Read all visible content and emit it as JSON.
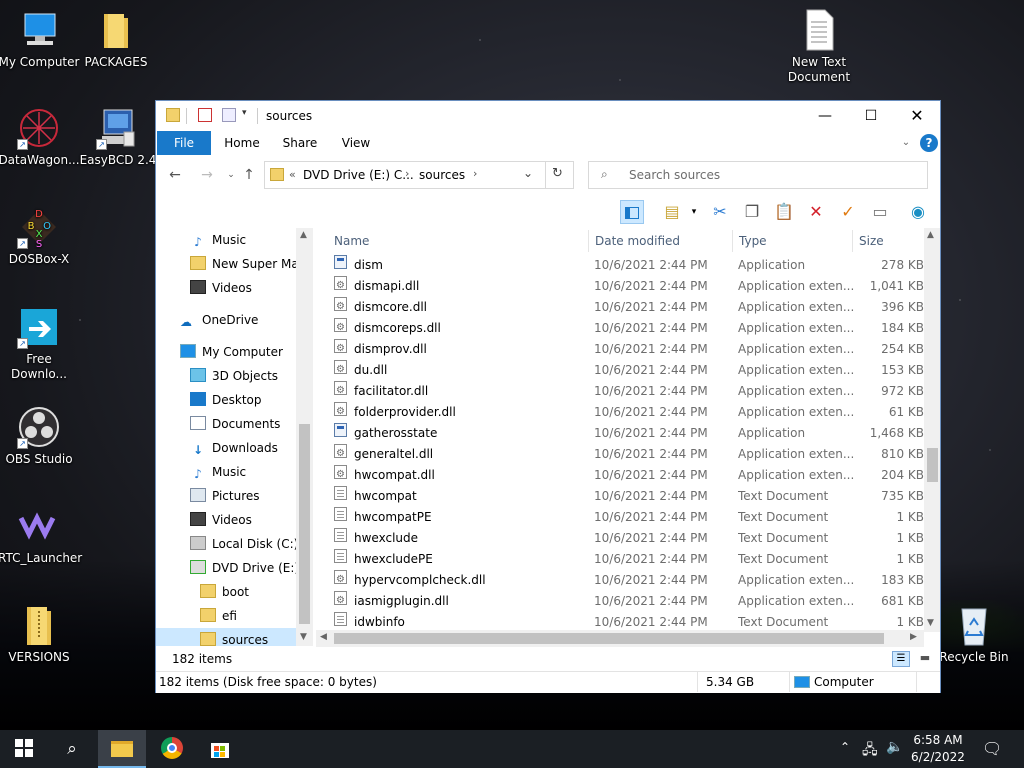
{
  "desktop": {
    "icons": [
      {
        "label": "My Computer"
      },
      {
        "label": "PACKAGES"
      },
      {
        "label": "DataWagon..."
      },
      {
        "label": "EasyBCD 2.4"
      },
      {
        "label": "DOSBox-X"
      },
      {
        "label": "Free Downlo..."
      },
      {
        "label": "OBS Studio"
      },
      {
        "label": "RTC_Launcher"
      },
      {
        "label": "VERSIONS"
      },
      {
        "label": "New Text Document"
      },
      {
        "label": "Recycle Bin"
      }
    ],
    "dosbox_letters": [
      "D",
      "B",
      "O",
      "X",
      "S"
    ]
  },
  "window": {
    "title": "sources",
    "ribbon_tabs": [
      "File",
      "Home",
      "Share",
      "View"
    ],
    "address": {
      "prefix": "«",
      "parts": [
        "DVD Drive (E:) C...",
        "sources"
      ]
    },
    "search_placeholder": "Search sources",
    "nav": [
      {
        "label": "Music"
      },
      {
        "label": "New Super Mario"
      },
      {
        "label": "Videos"
      },
      {
        "label": "OneDrive"
      },
      {
        "label": "My Computer"
      },
      {
        "label": "3D Objects"
      },
      {
        "label": "Desktop"
      },
      {
        "label": "Documents"
      },
      {
        "label": "Downloads"
      },
      {
        "label": "Music"
      },
      {
        "label": "Pictures"
      },
      {
        "label": "Videos"
      },
      {
        "label": "Local Disk (C:)"
      },
      {
        "label": "DVD Drive (E:) CC"
      },
      {
        "label": "boot"
      },
      {
        "label": "efi"
      },
      {
        "label": "sources"
      }
    ],
    "columns": [
      "Name",
      "Date modified",
      "Type",
      "Size"
    ],
    "files": [
      {
        "name": "dism",
        "date": "10/6/2021 2:44 PM",
        "type": "Application",
        "size": "278 KB",
        "kind": "app"
      },
      {
        "name": "dismapi.dll",
        "date": "10/6/2021 2:44 PM",
        "type": "Application exten...",
        "size": "1,041 KB",
        "kind": "dll"
      },
      {
        "name": "dismcore.dll",
        "date": "10/6/2021 2:44 PM",
        "type": "Application exten...",
        "size": "396 KB",
        "kind": "dll"
      },
      {
        "name": "dismcoreps.dll",
        "date": "10/6/2021 2:44 PM",
        "type": "Application exten...",
        "size": "184 KB",
        "kind": "dll"
      },
      {
        "name": "dismprov.dll",
        "date": "10/6/2021 2:44 PM",
        "type": "Application exten...",
        "size": "254 KB",
        "kind": "dll"
      },
      {
        "name": "du.dll",
        "date": "10/6/2021 2:44 PM",
        "type": "Application exten...",
        "size": "153 KB",
        "kind": "dll"
      },
      {
        "name": "facilitator.dll",
        "date": "10/6/2021 2:44 PM",
        "type": "Application exten...",
        "size": "972 KB",
        "kind": "dll"
      },
      {
        "name": "folderprovider.dll",
        "date": "10/6/2021 2:44 PM",
        "type": "Application exten...",
        "size": "61 KB",
        "kind": "dll"
      },
      {
        "name": "gatherosstate",
        "date": "10/6/2021 2:44 PM",
        "type": "Application",
        "size": "1,468 KB",
        "kind": "app"
      },
      {
        "name": "generaltel.dll",
        "date": "10/6/2021 2:44 PM",
        "type": "Application exten...",
        "size": "810 KB",
        "kind": "dll"
      },
      {
        "name": "hwcompat.dll",
        "date": "10/6/2021 2:44 PM",
        "type": "Application exten...",
        "size": "204 KB",
        "kind": "dll"
      },
      {
        "name": "hwcompat",
        "date": "10/6/2021 2:44 PM",
        "type": "Text Document",
        "size": "735 KB",
        "kind": "txt"
      },
      {
        "name": "hwcompatPE",
        "date": "10/6/2021 2:44 PM",
        "type": "Text Document",
        "size": "1 KB",
        "kind": "txt"
      },
      {
        "name": "hwexclude",
        "date": "10/6/2021 2:44 PM",
        "type": "Text Document",
        "size": "1 KB",
        "kind": "txt"
      },
      {
        "name": "hwexcludePE",
        "date": "10/6/2021 2:44 PM",
        "type": "Text Document",
        "size": "1 KB",
        "kind": "txt"
      },
      {
        "name": "hypervcomplcheck.dll",
        "date": "10/6/2021 2:44 PM",
        "type": "Application exten...",
        "size": "183 KB",
        "kind": "dll"
      },
      {
        "name": "iasmigplugin.dll",
        "date": "10/6/2021 2:44 PM",
        "type": "Application exten...",
        "size": "681 KB",
        "kind": "dll"
      },
      {
        "name": "idwbinfo",
        "date": "10/6/2021 2:44 PM",
        "type": "Text Document",
        "size": "1 KB",
        "kind": "txt"
      }
    ],
    "item_count": "182 items",
    "status_detail": "182 items (Disk free space: 0 bytes)",
    "status_size": "5.34 GB",
    "status_location": "Computer"
  },
  "taskbar": {
    "time": "6:58 AM",
    "date": "6/2/2022"
  },
  "colors": {
    "accent": "#1979ca",
    "selection": "#cce8ff"
  }
}
